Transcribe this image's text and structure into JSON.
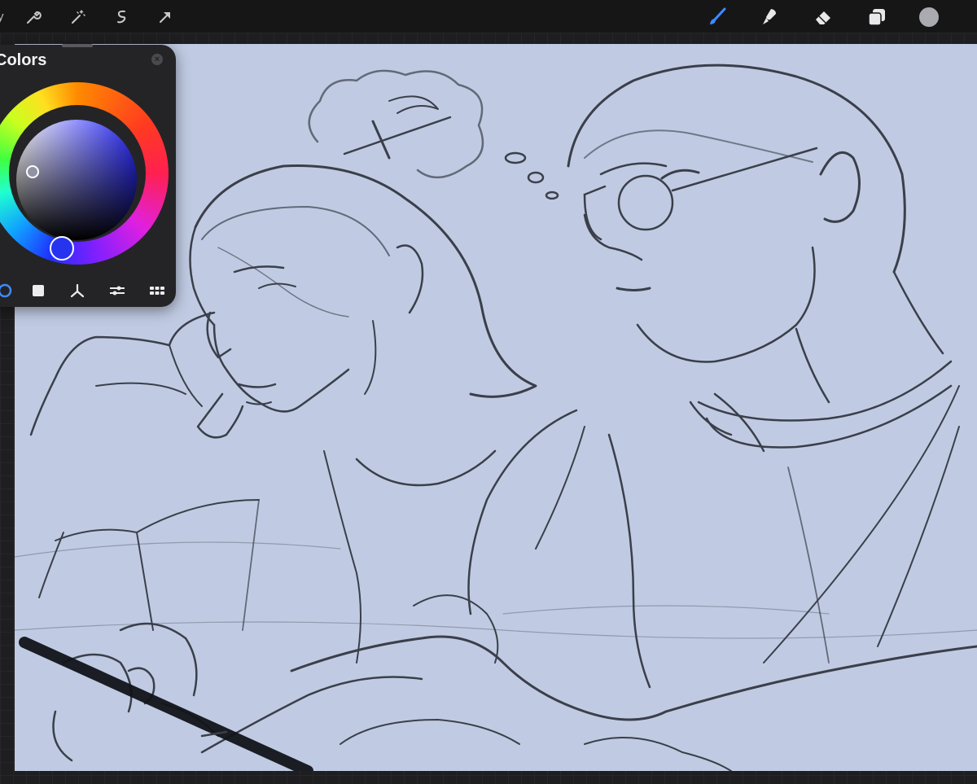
{
  "toolbar": {
    "gallery_label": "y",
    "left_tools": [
      {
        "name": "wrench-icon"
      },
      {
        "name": "magic-wand-icon"
      },
      {
        "name": "selection-icon"
      },
      {
        "name": "transform-arrow-icon"
      }
    ],
    "right_tools": [
      {
        "name": "brush-icon",
        "active": true,
        "color": "#3d8bff"
      },
      {
        "name": "smudge-icon"
      },
      {
        "name": "eraser-icon"
      },
      {
        "name": "layers-icon"
      },
      {
        "name": "color-swatch-icon",
        "color": "#a9abb1"
      }
    ]
  },
  "colors_panel": {
    "title": "Colors",
    "close_icon": "close-icon",
    "selected_color": "#2634f0",
    "canvas_color": "#c0cbe3",
    "modes": [
      {
        "name": "disc-mode-icon",
        "active": true
      },
      {
        "name": "classic-mode-icon"
      },
      {
        "name": "harmony-mode-icon"
      },
      {
        "name": "value-mode-icon"
      },
      {
        "name": "palettes-mode-icon"
      }
    ]
  }
}
